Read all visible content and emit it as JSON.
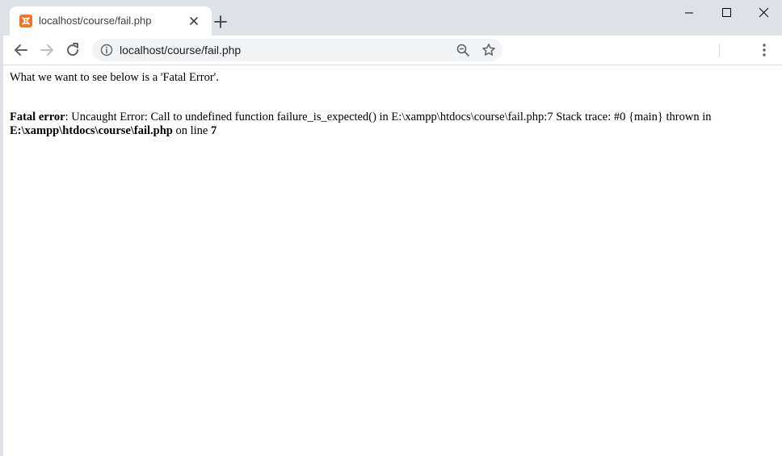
{
  "browser": {
    "tab": {
      "title": "localhost/course/fail.php",
      "favicon": "xampp-icon",
      "favicon_color": "#f37423"
    },
    "address_bar": {
      "url": "localhost/course/fail.php"
    },
    "accent": "#1a73e8"
  },
  "page": {
    "intro": "What we want to see below is a 'Fatal Error'.",
    "error": {
      "label": "Fatal error",
      "message": ": Uncaught Error: Call to undefined function failure_is_expected() in E:\\xampp\\htdocs\\course\\fail.php:7 Stack trace: #0 {main} thrown in ",
      "file": "E:\\xampp\\htdocs\\course\\fail.php",
      "on_line_text": " on line ",
      "line": "7"
    }
  }
}
